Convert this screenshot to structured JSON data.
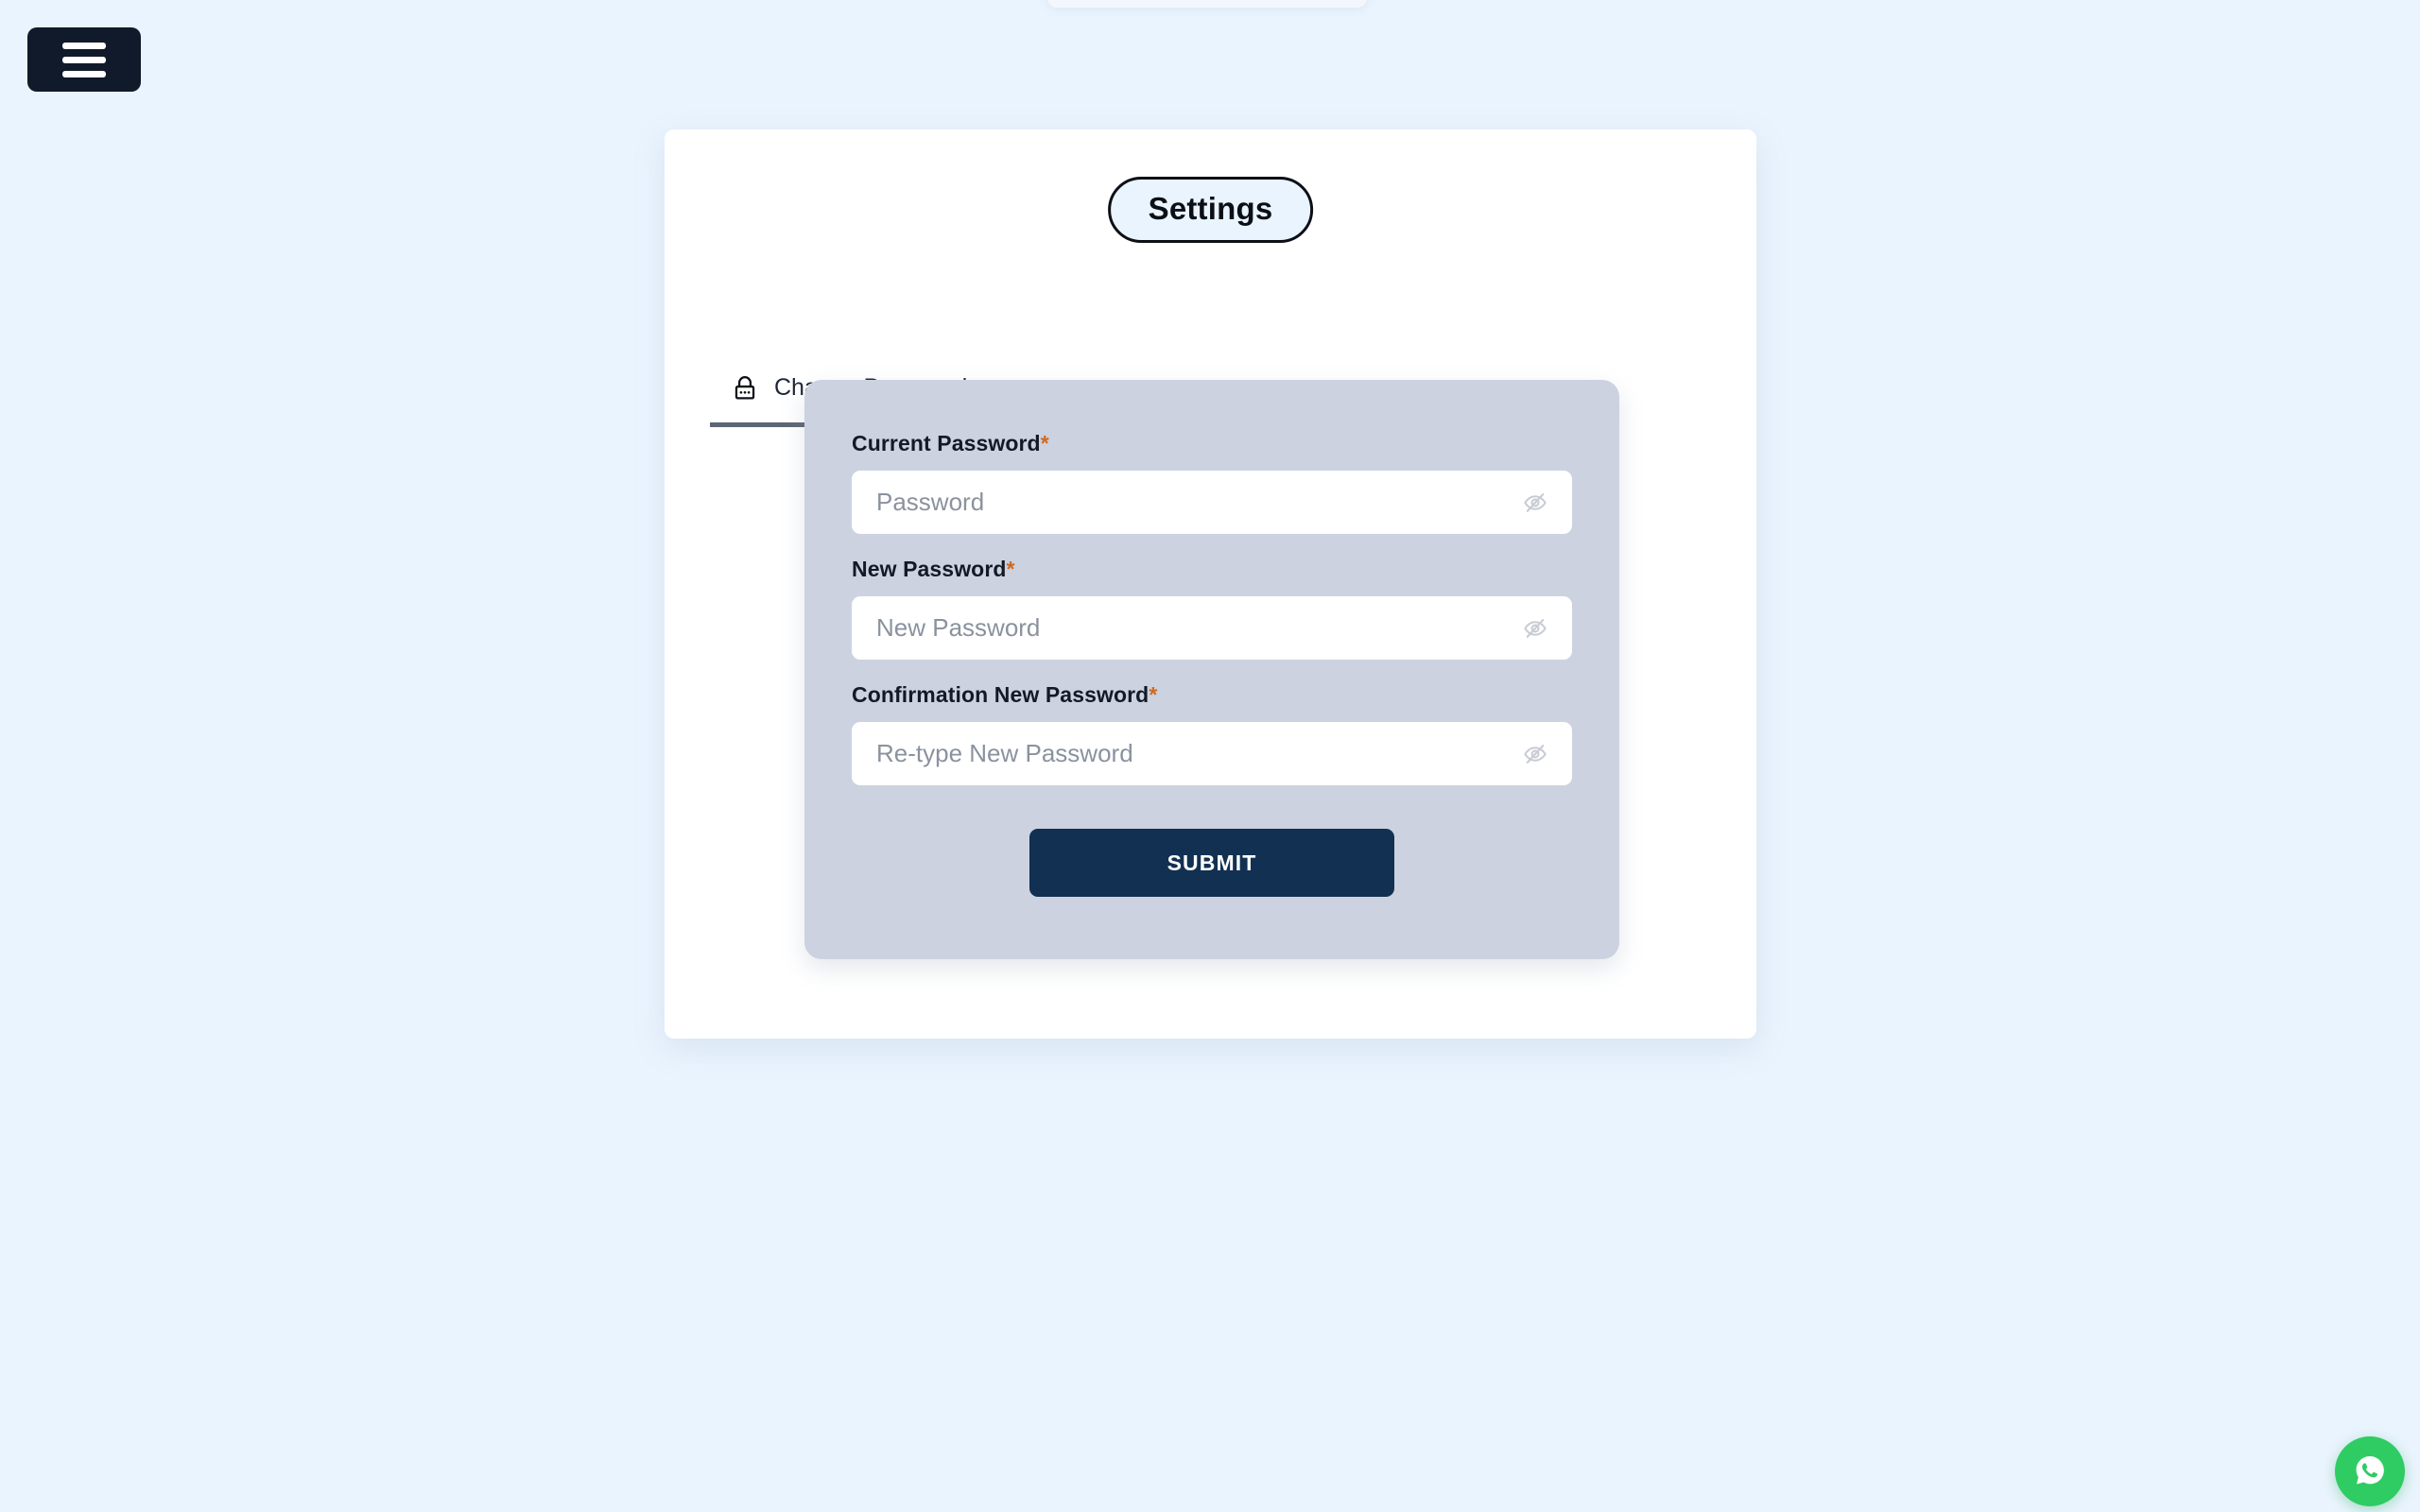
{
  "page": {
    "background_color": "#eaf4fe",
    "title": "Settings"
  },
  "header": {
    "menu_button_label": "Menu",
    "menu_icon": "hamburger-icon"
  },
  "tabs": [
    {
      "id": "change-password",
      "label": "Change Password",
      "icon": "lock-icon",
      "active": true
    }
  ],
  "form": {
    "panel_color": "#ccd2e0",
    "required_mark": "*",
    "fields": [
      {
        "id": "current-password",
        "label": "Current Password",
        "required": true,
        "placeholder": "Password",
        "value": "",
        "toggle_icon": "eye-off-icon"
      },
      {
        "id": "new-password",
        "label": "New Password",
        "required": true,
        "placeholder": "New Password",
        "value": "",
        "toggle_icon": "eye-off-icon"
      },
      {
        "id": "confirm-new-password",
        "label": "Confirmation New Password",
        "required": true,
        "placeholder": "Re-type New Password",
        "value": "",
        "toggle_icon": "eye-off-icon"
      }
    ],
    "submit_label": "SUBMIT",
    "submit_color": "#123052"
  },
  "floating_action": {
    "name": "whatsapp-button",
    "icon": "whatsapp-icon",
    "color": "#2ecc63"
  },
  "colors": {
    "accent_required": "#d2691e",
    "tab_underline": "#5d6675",
    "menu_button": "#111a2b",
    "card": "#ffffff"
  }
}
